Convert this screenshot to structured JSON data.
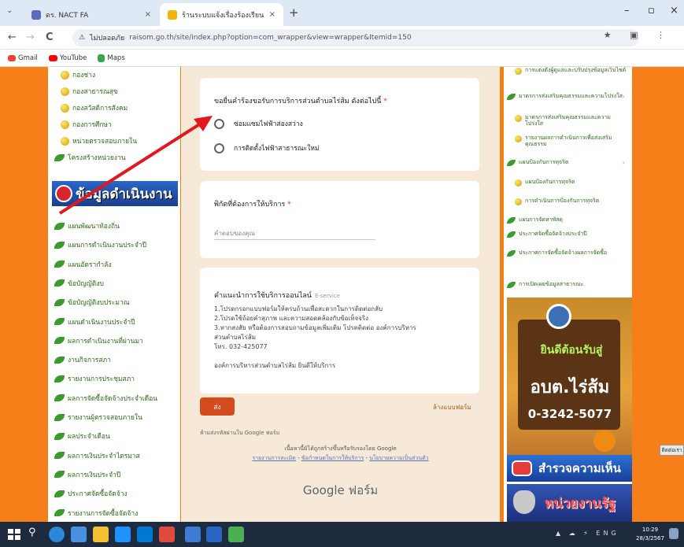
{
  "browser": {
    "tabs": [
      {
        "title": "ดร. NACT FA",
        "active": false
      },
      {
        "title": "ร้านระบบแจ้งเรื่องร้องเรียน",
        "active": true
      }
    ],
    "new_tab_glyph": "+",
    "window_controls": [
      "–",
      "▫",
      "×"
    ],
    "nav_glyphs": {
      "back": "←",
      "forward": "→",
      "reload": "C"
    },
    "site_info": "ไม่ปลอดภัย",
    "url": "raisom.go.th/site/index.php?option=com_wrapper&view=wrapper&Itemid=150",
    "omni_icons": "★ ▣ ⋮",
    "bookmarks": [
      {
        "label": "Gmail",
        "icon": "gmail-icon",
        "color": "#ea4335"
      },
      {
        "label": "YouTube",
        "icon": "youtube-icon",
        "color": "#ff0000"
      },
      {
        "label": "Maps",
        "icon": "maps-icon",
        "color": "#34a853"
      }
    ]
  },
  "left_nav": {
    "items_top": [
      {
        "label": "กองช่าง",
        "type": "sub"
      },
      {
        "label": "กองสาธารณสุข",
        "type": "sub"
      },
      {
        "label": "กองสวัสดิการสังคม",
        "type": "sub"
      },
      {
        "label": "กองการศึกษา",
        "type": "sub"
      },
      {
        "label": "หน่วยตรวจสอบภายใน",
        "type": "sub"
      },
      {
        "label": "โครงสร้างหน่วยงาน",
        "type": "main"
      }
    ],
    "banner": "ข้อมูลดำเนินงาน",
    "items_bottom": [
      "แผนพัฒนาท้องถิ่น",
      "แผนการดำเนินงานประจำปี",
      "แผนอัตรากำลัง",
      "ข้อบัญญัติงบ",
      "ข้อบัญญัติงบประมาณ",
      "แผนดำเนินงานประจำปี",
      "ผลการดำเนินงานที่ผ่านมา",
      "งานกิจการสภา",
      "รายงานการประชุมสภา",
      "ผลการจัดซื้อจัดจ้างประจำเดือน",
      "รายงานผู้ตรวจสอบภายใน",
      "ผลประจำเดือน",
      "ผลการเงินประจำไตรมาส",
      "ผลการเงินประจำปี",
      "ประกาศจัดซื้อจัดจ้าง",
      "รายงานการจัดซื้อจัดจ้าง"
    ]
  },
  "form": {
    "q1": {
      "title": "ขอยื่นคำร้องขอรับการบริการส่วนตำบลไร่ส้ม ดังต่อไปนี้",
      "required_mark": "*",
      "options": [
        "ซ่อมแซมไฟฟ้าส่องสว่าง",
        "การติดตั้งไฟฟ้าสาธารณะใหม่"
      ]
    },
    "q2": {
      "title": "พิกัดที่ต้องการให้บริการ",
      "required_mark": "*",
      "placeholder": "คำตอบของคุณ"
    },
    "info": {
      "title": "คำแนะนำการใช้บริการออนไลน์",
      "subtitle": "E-service",
      "lines": [
        "1.โปรดกรอกแบบฟอร์มให้ครบถ้วนเพื่อสะดวกในการติดต่อกลับ",
        "2.โปรดใช้ถ้อยคำสุภาพ และความสอดคล้องกับข้อเท็จจริง",
        "3.หากสงสัย หรือต้องการสอบถามข้อมูลเพิ่มเติม โปรดติดต่อ องค์การบริหาร",
        "ส่วนตำบลไร่ส้ม",
        "โทร. 032-425077",
        "",
        "องค์การบริหารส่วนตำบลไร่ส้ม ยินดีให้บริการ"
      ]
    },
    "submit_label": "ส่ง",
    "clear_label": "ล้างแบบฟอร์ม",
    "never_submit": "ห้ามส่งรหัสผ่านใน Google ฟอร์ม",
    "disclaimer": "เนื้อหานี้มิได้ถูกสร้างขึ้นหรือรับรองโดย Google",
    "disclaimer_links": [
      "รายงานการละเมิด",
      "ข้อกำหนดในการให้บริการ",
      "นโยบายความเป็นส่วนตัว"
    ],
    "google_logo": "Google ฟอร์ม"
  },
  "right_nav": {
    "items": [
      {
        "label": "การแต่งตั้งผู้ดูแลและปรับปรุงข้อมูลเว็บไซต์",
        "type": "sub"
      },
      {
        "label": "มาตรการส่งเสริมคุณธรรมและความโปร่งใส",
        "type": "main",
        "chevron": true
      },
      {
        "label": "มาตรการส่งเสริมคุณธรรมและความโปร่งใส",
        "type": "sub"
      },
      {
        "label": "รายงานผลการดำเนินการเพื่อส่งเสริมคุณธรรม",
        "type": "sub"
      },
      {
        "label": "แผนป้องกันการทุจริต",
        "type": "main",
        "chevron": true
      },
      {
        "label": "แผนป้องกันการทุจริต",
        "type": "sub"
      },
      {
        "label": "การดำเนินการป้องกันการทุจริต",
        "type": "sub"
      },
      {
        "label": "แผนการจัดหาพัสดุ",
        "type": "main"
      },
      {
        "label": "ประกาศจัดซื้อจัดจ้างประจำปี",
        "type": "main"
      },
      {
        "label": "ประกาศการจัดซื้อจัดจ้างผลการจัดซื้อ",
        "type": "main"
      },
      {
        "label": "การเปิดเผยข้อมูลสาธารณะ",
        "type": "main"
      }
    ],
    "promo_title": "ยินดีต้อนรับสู่",
    "promo_name": "อบต.ไร่ส้ม",
    "promo_phone": "0-3242-5077",
    "ad_survey": "สำรวจความเห็น",
    "ad_gov": "หน่วยงานรัฐ"
  },
  "feedback_label": "ติดต่อเรา",
  "taskbar": {
    "time": "10:29",
    "date": "28/3/2567",
    "tray": "▲ ☁ ⚡ ENG"
  }
}
